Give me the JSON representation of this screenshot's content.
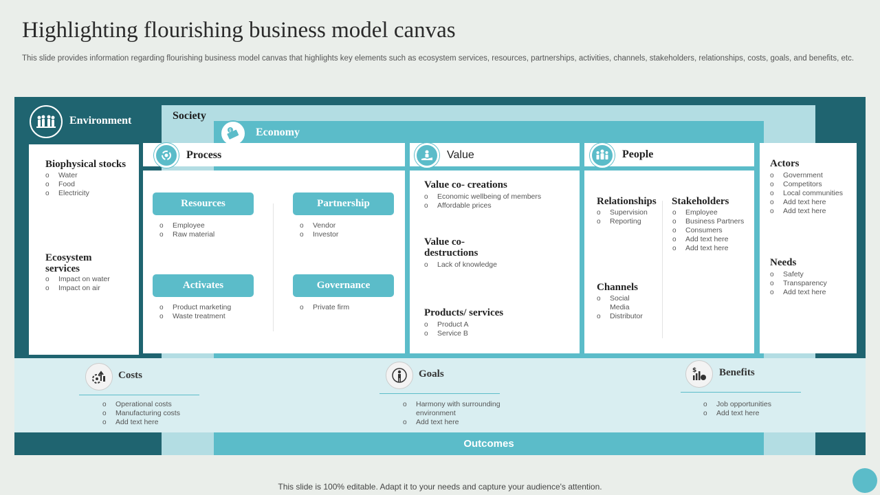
{
  "title": "Highlighting flourishing business model canvas",
  "subtitle": "This slide provides information regarding flourishing business model canvas that highlights key elements such as ecosystem services, resources, partnerships, activities, channels, stakeholders, relationships, costs, goals, and benefits, etc.",
  "bands": {
    "environment": "Environment",
    "society": "Society",
    "economy": "Economy",
    "outcomes": "Outcomes"
  },
  "left": {
    "biophysical": {
      "title": "Biophysical stocks",
      "items": [
        "Water",
        "Food",
        "Electricity"
      ]
    },
    "ecosystem": {
      "title_line1": "Ecosystem",
      "title_line2": "services",
      "items": [
        "Impact on water",
        "Impact on air"
      ]
    }
  },
  "process": {
    "header": "Process",
    "resources": {
      "label": "Resources",
      "items": [
        "Employee",
        "Raw material"
      ]
    },
    "partnership": {
      "label": "Partnership",
      "items": [
        "Vendor",
        "Investor"
      ]
    },
    "activates": {
      "label": "Activates",
      "items": [
        "Product marketing",
        "Waste treatment"
      ]
    },
    "governance": {
      "label": "Governance",
      "items": [
        "Private firm"
      ]
    }
  },
  "value": {
    "header": "Value",
    "cocreations": {
      "title": "Value co- creations",
      "items": [
        "Economic  wellbeing of members",
        "Affordable prices"
      ]
    },
    "codestructions": {
      "title_line1": "Value co-",
      "title_line2": "destructions",
      "items": [
        "Lack of knowledge"
      ]
    },
    "products": {
      "title": "Products/ services",
      "items": [
        "Product A",
        "Service B"
      ]
    }
  },
  "people": {
    "header": "People",
    "relationships": {
      "title": "Relationships",
      "items": [
        "Supervision",
        "Reporting"
      ]
    },
    "stakeholders": {
      "title": "Stakeholders",
      "items": [
        "Employee",
        "Business Partners",
        "Consumers",
        "Add text here",
        "Add text here"
      ]
    },
    "channels": {
      "title": "Channels",
      "items": [
        "Social",
        "Media",
        "Distributor"
      ]
    }
  },
  "right": {
    "actors": {
      "title": "Actors",
      "items": [
        "Government",
        "Competitors",
        "Local communities",
        "Add text here",
        "Add text here"
      ]
    },
    "needs": {
      "title": "Needs",
      "items": [
        "Safety",
        "Transparency",
        "Add text here"
      ]
    }
  },
  "outcomes": {
    "costs": {
      "title": "Costs",
      "items": [
        "Operational costs",
        "Manufacturing costs",
        "Add text here"
      ]
    },
    "goals": {
      "title": "Goals",
      "items": [
        "Harmony with surrounding",
        "environment",
        "Add text here"
      ]
    },
    "benefits": {
      "title": "Benefits",
      "items": [
        "Job opportunities",
        "Add text here"
      ]
    }
  },
  "footer": "This slide is 100% editable. Adapt it to your needs and capture your audience's attention.",
  "colors": {
    "dark_teal": "#1f6470",
    "light_teal": "#b3dde3",
    "teal": "#5bbcc9",
    "outcome_bg": "#d9eef1"
  },
  "icons": [
    "people-group-icon",
    "money-icon",
    "gear-cycle-icon",
    "hand-people-icon",
    "team-icon",
    "cost-gear-icon",
    "goal-person-icon",
    "benefits-chart-icon"
  ]
}
